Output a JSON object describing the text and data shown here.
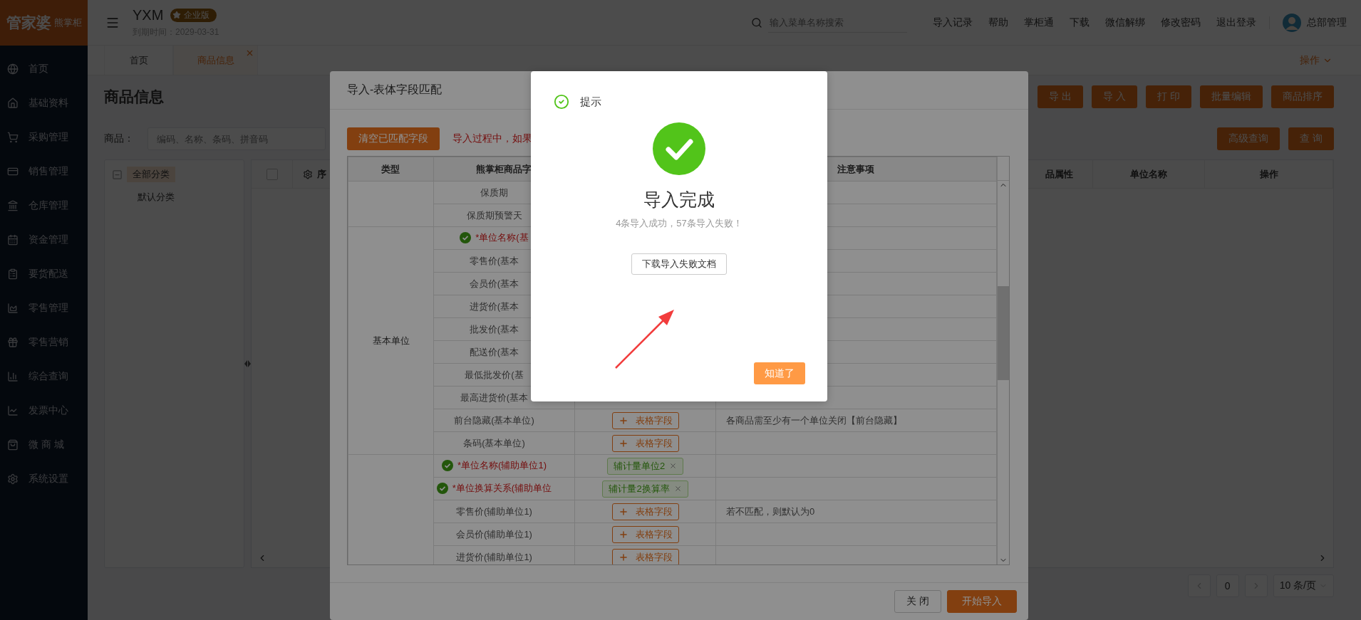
{
  "sidebar": {
    "logo": {
      "brand": "管家婆",
      "product": "熊掌柜"
    },
    "items": [
      {
        "label": "首页"
      },
      {
        "label": "基础资料"
      },
      {
        "label": "采购管理"
      },
      {
        "label": "销售管理"
      },
      {
        "label": "仓库管理"
      },
      {
        "label": "资金管理"
      },
      {
        "label": "要货配送"
      },
      {
        "label": "零售管理"
      },
      {
        "label": "零售营销"
      },
      {
        "label": "综合查询"
      },
      {
        "label": "发票中心"
      },
      {
        "label": "微 商 城"
      },
      {
        "label": "系统设置"
      }
    ]
  },
  "header": {
    "company": "YXM",
    "edition": "企业版",
    "expiry": "到期时间：2029-03-31",
    "search": {
      "placeholder": "输入菜单名称搜索"
    },
    "links": [
      "导入记录",
      "帮助",
      "掌柜通",
      "下载",
      "微信解绑",
      "修改密码",
      "退出登录"
    ],
    "user": "总部管理"
  },
  "tabs": [
    {
      "label": "首页",
      "selected": false,
      "closable": false
    },
    {
      "label": "商品信息",
      "selected": true,
      "closable": true
    }
  ],
  "ops_menu": "操作",
  "page": {
    "title": "商品信息",
    "toolbar": [
      "导 出",
      "导 入",
      "打 印",
      "批量编辑",
      "商品排序"
    ],
    "filter_label": "商品：",
    "filter": {
      "placeholder": "编码、名称、条码、拼音码"
    },
    "query_buttons": [
      "高级查询",
      "查 询"
    ],
    "tree": [
      {
        "label": "全部分类",
        "selected": true,
        "expanded": true,
        "children": [
          {
            "label": "默认分类",
            "selected": false
          }
        ]
      }
    ],
    "select_all": {
      "checked": false
    },
    "columns": [
      "序",
      "品属性",
      "单位名称",
      "操作"
    ],
    "pagination": {
      "page": "0",
      "page_size": "10 条/页"
    }
  },
  "import_dialog": {
    "title": "导入-表体字段匹配",
    "clear_button": "清空已匹配字段",
    "warning": "导入过程中，如果",
    "columns": [
      "类型",
      "熊掌柜商品字",
      "注意事项"
    ],
    "groups": [
      {
        "rows": [
          {
            "name": "保质期",
            "required": false,
            "matched": false
          },
          {
            "name": "保质期预警天",
            "required": false,
            "matched": false
          }
        ]
      },
      {
        "type": "基本单位",
        "rows": [
          {
            "name": "*单位名称(基",
            "required": true,
            "matched": true
          },
          {
            "name": "零售价(基本",
            "required": false,
            "matched": false
          },
          {
            "name": "会员价(基本",
            "required": false,
            "matched": false
          },
          {
            "name": "进货价(基本",
            "required": false,
            "matched": false
          },
          {
            "name": "批发价(基本",
            "required": false,
            "matched": false
          },
          {
            "name": "配送价(基本",
            "required": false,
            "matched": false
          },
          {
            "name": "最低批发价(基",
            "required": false,
            "matched": false
          },
          {
            "name": "最高进货价(基本",
            "required": false,
            "matched": false
          },
          {
            "name": "前台隐藏(基本单位)",
            "required": false,
            "matched": false,
            "field": {
              "kind": "add",
              "label": "表格字段"
            },
            "note": "各商品需至少有一个单位关闭【前台隐藏】"
          },
          {
            "name": "条码(基本单位)",
            "required": false,
            "matched": false,
            "field": {
              "kind": "add",
              "label": "表格字段"
            }
          }
        ]
      },
      {
        "rows": [
          {
            "name": "*单位名称(辅助单位1)",
            "required": true,
            "matched": true,
            "field": {
              "kind": "tag",
              "label": "辅计量单位2"
            }
          },
          {
            "name": "*单位换算关系(辅助单位",
            "required": true,
            "matched": true,
            "field": {
              "kind": "tag",
              "label": "辅计量2换算率"
            }
          },
          {
            "name": "零售价(辅助单位1)",
            "required": false,
            "matched": false,
            "field": {
              "kind": "add",
              "label": "表格字段"
            },
            "note": "若不匹配，则默认为0"
          },
          {
            "name": "会员价(辅助单位1)",
            "required": false,
            "matched": false,
            "field": {
              "kind": "add",
              "label": "表格字段"
            }
          },
          {
            "name": "进货价(辅助单位1)",
            "required": false,
            "matched": false,
            "field": {
              "kind": "add",
              "label": "表格字段"
            }
          }
        ]
      }
    ],
    "buttons": [
      {
        "label": "关 闭",
        "kind": "secondary"
      },
      {
        "label": "开始导入",
        "kind": "primary"
      }
    ]
  },
  "notice": {
    "title": "提示",
    "heading": "导入完成",
    "message": "4条导入成功，57条导入失败！",
    "download_button": "下载导入失败文档",
    "ok_button": "知道了"
  }
}
